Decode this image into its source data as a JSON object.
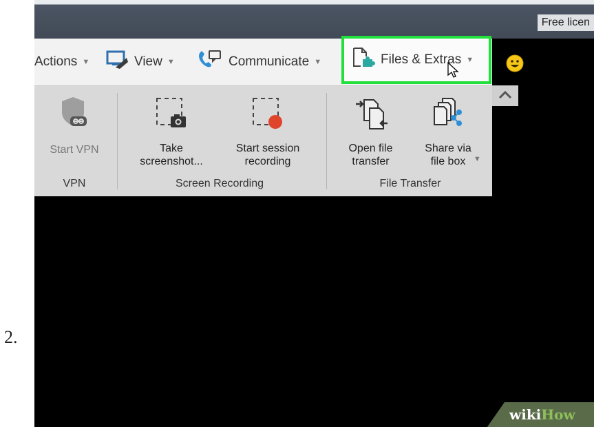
{
  "step": {
    "number": "2."
  },
  "titlebar": {
    "license_text": "Free licen"
  },
  "menubar": {
    "actions_label": "Actions",
    "view_label": "View",
    "communicate_label": "Communicate",
    "files_extras_label": "Files & Extras"
  },
  "ribbon": {
    "vpn": {
      "start_vpn_label": "Start VPN",
      "group_label": "VPN"
    },
    "screen_recording": {
      "take_screenshot_label": "Take\nscreenshot...",
      "start_session_recording_label": "Start session\nrecording",
      "group_label": "Screen Recording"
    },
    "file_transfer": {
      "open_file_transfer_label": "Open file\ntransfer",
      "share_via_file_box_label": "Share via\nfile box",
      "group_label": "File Transfer"
    }
  },
  "watermark": {
    "part1": "wiki",
    "part2": "How"
  },
  "icons": {
    "actions_caret": "chevron-down-icon",
    "view": "monitor-icon",
    "communicate": "chat-phone-icon",
    "files_extras": "puzzle-document-icon",
    "emoji": "smiley-icon",
    "cursor": "mouse-pointer-icon",
    "vpn": "shield-link-icon",
    "screenshot": "camera-frame-icon",
    "recording": "record-frame-icon",
    "open_file_transfer": "file-transfer-icon",
    "share_file_box": "file-share-icon",
    "collapse": "chevron-up-icon"
  },
  "colors": {
    "highlight": "#22e03c",
    "record_dot": "#e0442a",
    "accent_blue": "#2f8fd6"
  }
}
